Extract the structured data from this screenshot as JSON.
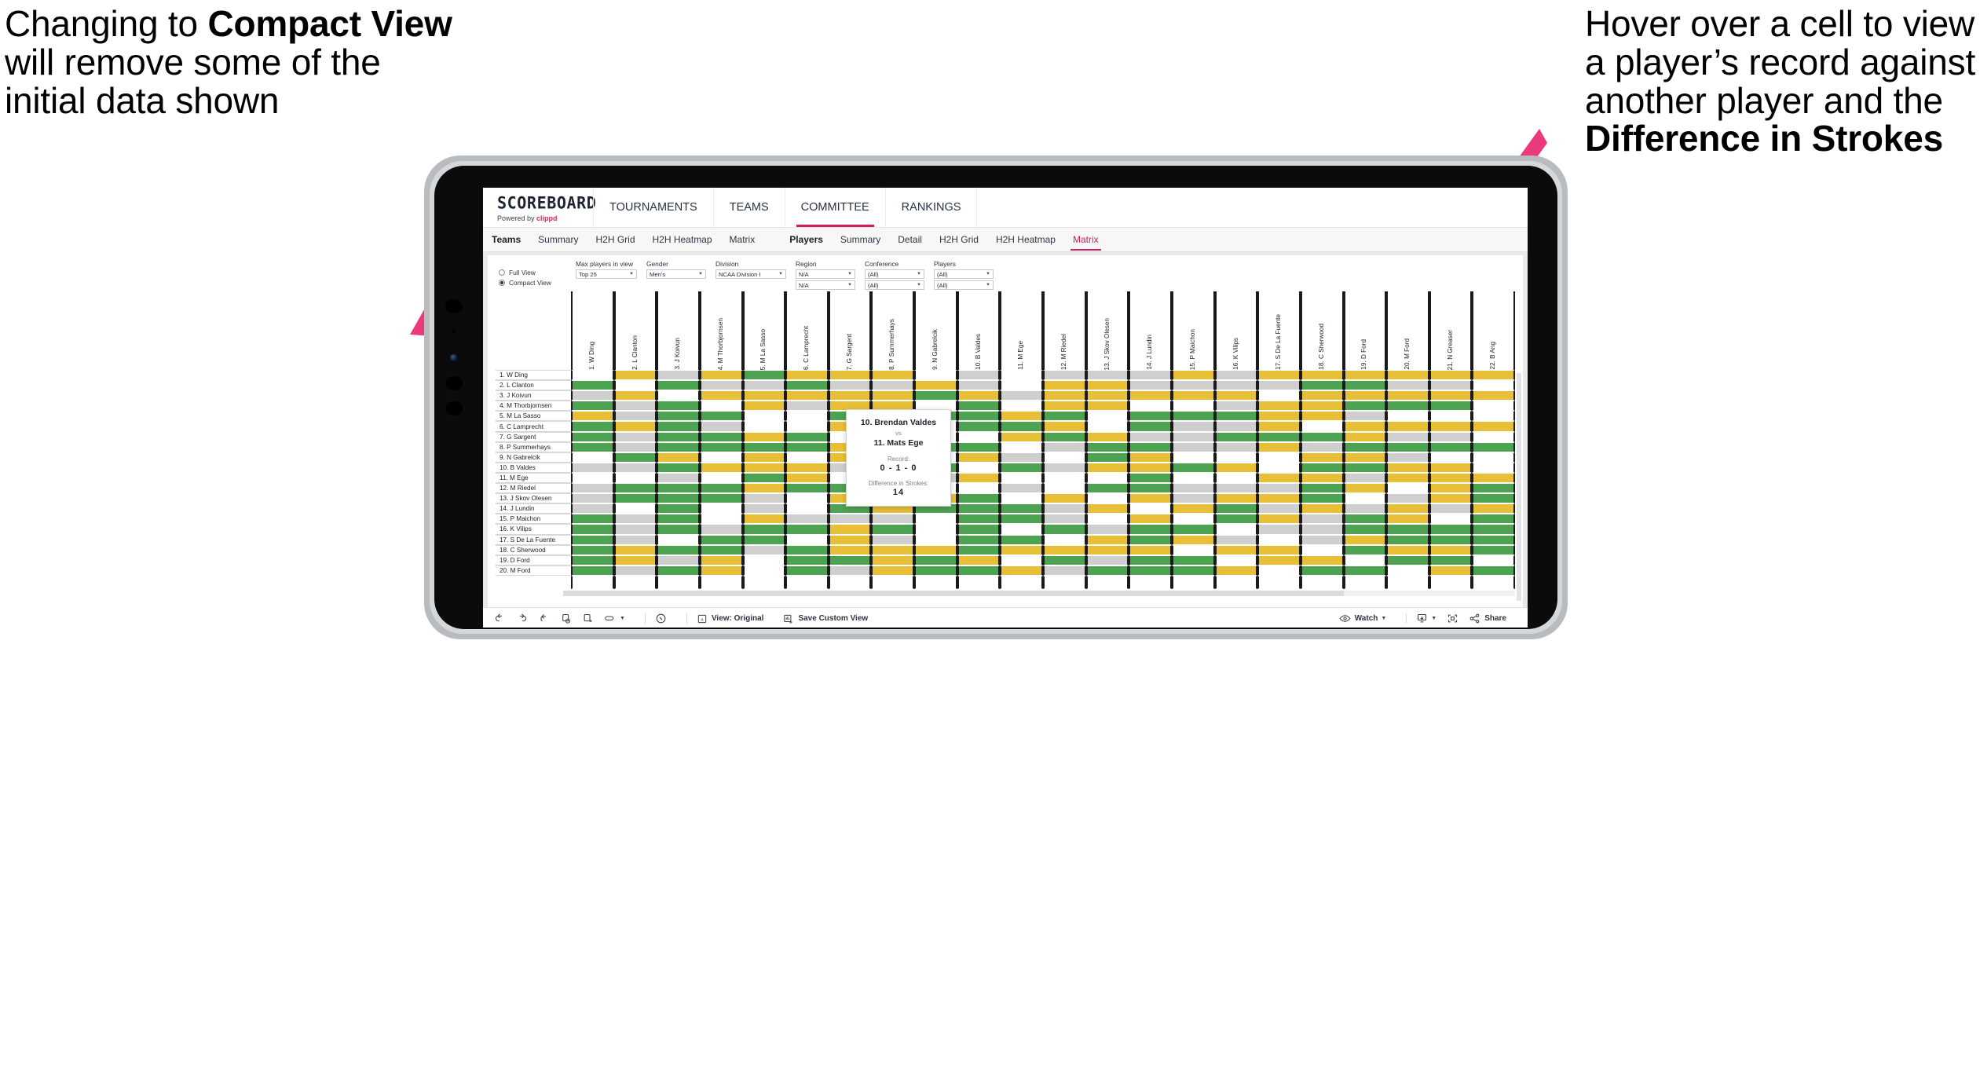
{
  "annotations": {
    "left": {
      "line1": "Changing to ",
      "bold1": "Compact View",
      "line2": " will remove some of the initial data shown"
    },
    "right": {
      "line1": "Hover over a cell to view a player’s record against another player and the ",
      "bold1": "Difference in Strokes"
    },
    "arrow_color": "#ea3a7c"
  },
  "app": {
    "brand": {
      "title": "SCOREBOARD",
      "powered_prefix": "Powered by ",
      "powered_name": "clippd"
    },
    "nav_tabs": [
      {
        "label": "TOURNAMENTS",
        "selected": false
      },
      {
        "label": "TEAMS",
        "selected": false
      },
      {
        "label": "COMMITTEE",
        "selected": true
      },
      {
        "label": "RANKINGS",
        "selected": false
      }
    ],
    "sub_nav": {
      "group_teams": [
        {
          "label": "Teams",
          "header": true
        },
        {
          "label": "Summary"
        },
        {
          "label": "H2H Grid"
        },
        {
          "label": "H2H Heatmap"
        },
        {
          "label": "Matrix"
        }
      ],
      "group_players": [
        {
          "label": "Players",
          "header": true
        },
        {
          "label": "Summary"
        },
        {
          "label": "Detail"
        },
        {
          "label": "H2H Grid"
        },
        {
          "label": "H2H Heatmap"
        },
        {
          "label": "Matrix",
          "active": true
        }
      ]
    }
  },
  "filters": {
    "view_mode": {
      "options": [
        "Full View",
        "Compact View"
      ],
      "selected": "Compact View"
    },
    "controls": [
      {
        "label": "Max players in view",
        "value": "Top 25"
      },
      {
        "label": "Gender",
        "value": "Men’s"
      },
      {
        "label": "Division",
        "value": "NCAA Division I"
      },
      {
        "label": "Region",
        "value": "N/A",
        "value2": "N/A"
      },
      {
        "label": "Conference",
        "value": "(All)",
        "value2": "(All)"
      },
      {
        "label": "Players",
        "value": "(All)",
        "value2": "(All)"
      }
    ]
  },
  "matrix": {
    "row_labels": [
      "1. W Ding",
      "2. L Clanton",
      "3. J Koivun",
      "4. M Thorbjornsen",
      "5. M La Sasso",
      "6. C Lamprecht",
      "7. G Sargent",
      "8. P Summerhays",
      "9. N Gabrelcik",
      "10. B Valdes",
      "11. M Ege",
      "12. M Riedel",
      "13. J Skov Olesen",
      "14. J Lundin",
      "15. P Maichon",
      "16. K Vilips",
      "17. S De La Fuente",
      "18. C Sherwood",
      "19. D Ford",
      "20. M Ford"
    ],
    "col_labels": [
      "1. W Ding",
      "2. L Clanton",
      "3. J Koivun",
      "4. M Thorbjornsen",
      "5. M La Sasso",
      "6. C Lamprecht",
      "7. G Sargent",
      "8. P Summerhays",
      "9. N Gabrelcik",
      "10. B Valdes",
      "11. M Ege",
      "12. M Riedel",
      "13. J Skov Olesen",
      "14. J Lundin",
      "15. P Maichon",
      "16. K Vilips",
      "17. S De La Fuente",
      "18. C Sherwood",
      "19. D Ford",
      "20. M Ford",
      "21. N Greaser",
      "22. B Ang"
    ],
    "legend_colors": {
      "win": "#4da352",
      "tie": "#e8c037",
      "loss": "#cfcfcf",
      "none": "#ffffff"
    },
    "cells": [
      [
        "w",
        "y",
        "a",
        "y",
        "g",
        "y",
        "y",
        "y",
        "w",
        "a",
        "w",
        "a",
        "a",
        "a",
        "y",
        "a",
        "y",
        "y",
        "y",
        "y",
        "y",
        "y"
      ],
      [
        "g",
        "w",
        "g",
        "a",
        "a",
        "g",
        "a",
        "a",
        "y",
        "a",
        "w",
        "y",
        "y",
        "a",
        "a",
        "a",
        "a",
        "g",
        "g",
        "a",
        "a",
        "w"
      ],
      [
        "a",
        "y",
        "w",
        "y",
        "y",
        "y",
        "y",
        "y",
        "g",
        "y",
        "a",
        "y",
        "y",
        "y",
        "y",
        "y",
        "w",
        "y",
        "y",
        "y",
        "y",
        "y"
      ],
      [
        "g",
        "a",
        "g",
        "w",
        "y",
        "a",
        "y",
        "y",
        "w",
        "g",
        "w",
        "y",
        "y",
        "w",
        "w",
        "a",
        "y",
        "y",
        "g",
        "g",
        "g",
        "w"
      ],
      [
        "y",
        "a",
        "g",
        "g",
        "w",
        "w",
        "g",
        "y",
        "g",
        "g",
        "y",
        "g",
        "w",
        "g",
        "g",
        "g",
        "y",
        "y",
        "a",
        "w",
        "w",
        "w"
      ],
      [
        "g",
        "y",
        "g",
        "a",
        "w",
        "w",
        "y",
        "y",
        "w",
        "g",
        "g",
        "y",
        "w",
        "g",
        "a",
        "a",
        "y",
        "w",
        "y",
        "y",
        "y",
        "y"
      ],
      [
        "g",
        "a",
        "g",
        "g",
        "y",
        "g",
        "w",
        "g",
        "w",
        "w",
        "y",
        "g",
        "y",
        "a",
        "a",
        "g",
        "g",
        "g",
        "y",
        "a",
        "a",
        "w"
      ],
      [
        "g",
        "a",
        "g",
        "g",
        "g",
        "g",
        "y",
        "w",
        "g",
        "g",
        "w",
        "a",
        "g",
        "g",
        "a",
        "a",
        "y",
        "a",
        "g",
        "g",
        "g",
        "g"
      ],
      [
        "w",
        "g",
        "y",
        "w",
        "y",
        "w",
        "y",
        "w",
        "w",
        "y",
        "a",
        "w",
        "g",
        "y",
        "w",
        "w",
        "w",
        "y",
        "y",
        "a",
        "w",
        "w"
      ],
      [
        "a",
        "a",
        "g",
        "y",
        "y",
        "y",
        "a",
        "y",
        "g",
        "w",
        "g",
        "a",
        "y",
        "y",
        "g",
        "y",
        "w",
        "g",
        "g",
        "y",
        "y",
        "w"
      ],
      [
        "w",
        "w",
        "a",
        "w",
        "g",
        "y",
        "w",
        "w",
        "a",
        "y",
        "w",
        "w",
        "w",
        "g",
        "w",
        "w",
        "y",
        "y",
        "a",
        "y",
        "y",
        "y"
      ],
      [
        "a",
        "g",
        "g",
        "g",
        "y",
        "g",
        "g",
        "a",
        "w",
        "w",
        "a",
        "w",
        "g",
        "g",
        "a",
        "a",
        "a",
        "g",
        "y",
        "w",
        "y",
        "g"
      ],
      [
        "a",
        "g",
        "g",
        "g",
        "a",
        "w",
        "y",
        "a",
        "y",
        "g",
        "w",
        "y",
        "w",
        "y",
        "a",
        "y",
        "y",
        "g",
        "w",
        "a",
        "y",
        "g"
      ],
      [
        "a",
        "w",
        "g",
        "w",
        "a",
        "w",
        "g",
        "y",
        "g",
        "g",
        "g",
        "a",
        "y",
        "w",
        "y",
        "g",
        "a",
        "y",
        "a",
        "y",
        "a",
        "y"
      ],
      [
        "g",
        "a",
        "g",
        "w",
        "y",
        "a",
        "a",
        "a",
        "w",
        "g",
        "g",
        "a",
        "w",
        "y",
        "w",
        "g",
        "y",
        "a",
        "g",
        "y",
        "w",
        "g"
      ],
      [
        "g",
        "a",
        "g",
        "a",
        "g",
        "g",
        "y",
        "g",
        "w",
        "g",
        "w",
        "g",
        "a",
        "g",
        "g",
        "w",
        "a",
        "a",
        "g",
        "g",
        "g",
        "g"
      ],
      [
        "g",
        "a",
        "w",
        "g",
        "g",
        "w",
        "y",
        "a",
        "w",
        "g",
        "g",
        "w",
        "y",
        "g",
        "y",
        "a",
        "w",
        "a",
        "y",
        "g",
        "g",
        "g"
      ],
      [
        "g",
        "y",
        "g",
        "g",
        "a",
        "g",
        "y",
        "y",
        "y",
        "g",
        "y",
        "y",
        "y",
        "y",
        "w",
        "y",
        "y",
        "w",
        "g",
        "y",
        "y",
        "g"
      ],
      [
        "g",
        "y",
        "a",
        "y",
        "w",
        "g",
        "g",
        "y",
        "g",
        "y",
        "w",
        "g",
        "a",
        "g",
        "g",
        "w",
        "y",
        "y",
        "w",
        "g",
        "g",
        "w"
      ],
      [
        "g",
        "a",
        "g",
        "y",
        "w",
        "g",
        "a",
        "y",
        "g",
        "g",
        "y",
        "a",
        "g",
        "g",
        "g",
        "y",
        "w",
        "g",
        "g",
        "w",
        "y",
        "g"
      ]
    ]
  },
  "tooltip": {
    "player_a": "10. Brendan Valdes",
    "vs": "vs",
    "player_b": "11. Mats Ege",
    "record_label": "Record:",
    "record_value": "0 - 1 - 0",
    "strokes_label": "Difference in Strokes:",
    "strokes_value": "14"
  },
  "toolbar": {
    "items": [
      {
        "name": "undo",
        "label": ""
      },
      {
        "name": "redo",
        "label": ""
      },
      {
        "name": "revert",
        "label": ""
      },
      {
        "name": "refresh",
        "label": ""
      },
      {
        "name": "pause",
        "label": ""
      },
      {
        "name": "highlight",
        "label": "",
        "caret": true
      },
      {
        "name": "help",
        "label": ""
      }
    ],
    "view_original": "View: Original",
    "save_custom_view": "Save Custom View",
    "watch": "Watch",
    "share": "Share"
  }
}
